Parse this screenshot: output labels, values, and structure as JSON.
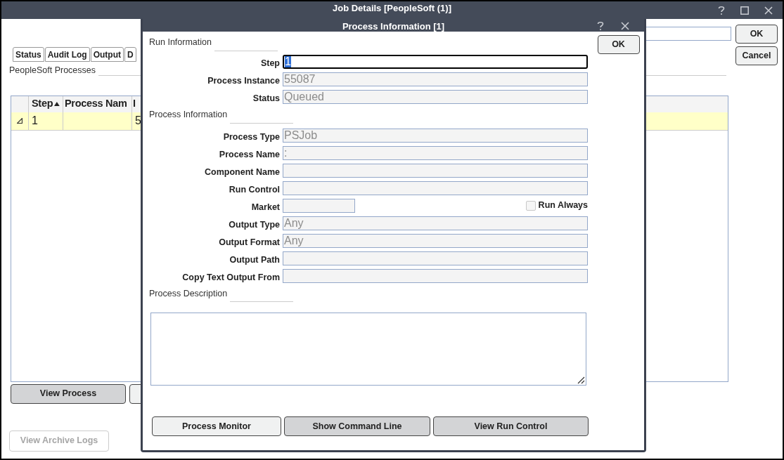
{
  "window": {
    "title": "Job Details [PeopleSoft (1)]"
  },
  "tabs": [
    {
      "label": "Status"
    },
    {
      "label": "Audit Log"
    },
    {
      "label": "Output"
    },
    {
      "label": "D"
    }
  ],
  "section_label": "PeopleSoft Processes",
  "table": {
    "columns": [
      {
        "label": "Step",
        "sorted_ascending": true
      },
      {
        "label": "Process Nam",
        "sorted_ascending": false
      },
      {
        "label": "I",
        "sorted_ascending": false
      }
    ],
    "rows": [
      {
        "cells": [
          "1",
          "",
          "5"
        ],
        "selected": true
      }
    ]
  },
  "bottom_buttons": [
    {
      "label": "View Process",
      "shaded": true
    }
  ],
  "archive_button": {
    "label": "View Archive Logs",
    "disabled": true
  },
  "side_buttons": [
    "OK",
    "Cancel"
  ],
  "dialog": {
    "title": "Process Information [1]",
    "ok": "OK",
    "sections": [
      {
        "title": "Run Information",
        "fields": [
          {
            "kind": "text",
            "label": "Step",
            "value": "1",
            "focused": true,
            "disabled": false
          },
          {
            "kind": "text",
            "label": "Process Instance",
            "value": "55087",
            "focused": false,
            "disabled": true
          },
          {
            "kind": "text",
            "label": "Status",
            "value": "Queued",
            "focused": false,
            "disabled": true
          }
        ]
      },
      {
        "title": "Process Information",
        "fields": [
          {
            "kind": "text",
            "label": "Process Type",
            "value": "PSJob",
            "focused": false,
            "disabled": true
          },
          {
            "kind": "text",
            "label": "Process Name",
            "value": ":",
            "focused": false,
            "disabled": true
          },
          {
            "kind": "text",
            "label": "Component Name",
            "focused": false
          },
          {
            "kind": "text",
            "label": "Run Control",
            "focused": false
          },
          {
            "kind": "short",
            "label": "Market",
            "focused": false,
            "checkbox": {
              "label": "Run Always",
              "checked": false
            }
          },
          {
            "kind": "text",
            "label": "Output Type",
            "value": "Any",
            "focused": false,
            "disabled": true
          },
          {
            "kind": "text",
            "label": "Output Format",
            "value": "Any",
            "focused": false,
            "disabled": true
          },
          {
            "kind": "text",
            "label": "Output Path",
            "focused": false
          },
          {
            "kind": "text",
            "label": "Copy Text Output From",
            "focused": false
          }
        ]
      },
      {
        "title": "Process Description",
        "fields": [
          {
            "kind": "textarea"
          }
        ]
      }
    ],
    "buttons": [
      {
        "label": "Process Monitor",
        "shaded": false
      },
      {
        "label": "Show Command Line",
        "shaded": true
      },
      {
        "label": "View Run Control",
        "shaded": true
      }
    ]
  }
}
